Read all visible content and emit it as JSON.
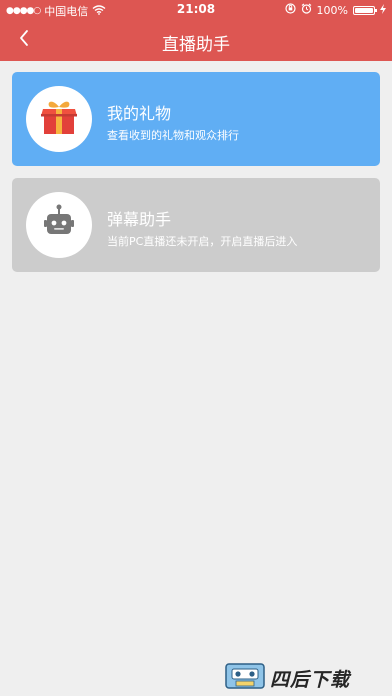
{
  "status_bar": {
    "signal_dots": "●●●●○",
    "carrier": "中国电信",
    "time": "21:08",
    "battery_percent": "100%"
  },
  "nav": {
    "title": "直播助手"
  },
  "cards": [
    {
      "title": "我的礼物",
      "subtitle": "查看收到的礼物和观众排行",
      "icon": "gift-icon",
      "color": "#60aef4"
    },
    {
      "title": "弹幕助手",
      "subtitle": "当前PC直播还未开启，开启直播后进入",
      "icon": "robot-icon",
      "color": "#cccccc"
    }
  ],
  "watermark": {
    "text": "四后下载"
  },
  "colors": {
    "header": "#dd5652",
    "background": "#efefef"
  }
}
